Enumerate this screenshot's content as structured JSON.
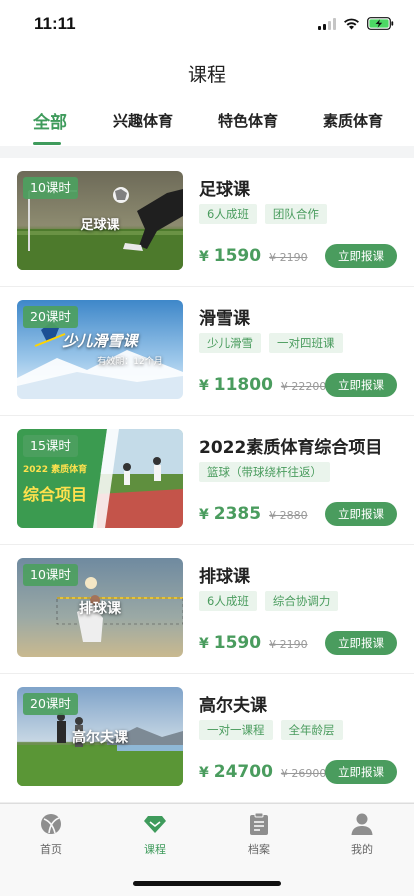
{
  "status_bar": {
    "time": "11:11"
  },
  "header": {
    "title": "课程"
  },
  "tabs": [
    {
      "label": "全部",
      "active": true
    },
    {
      "label": "兴趣体育"
    },
    {
      "label": "特色体育"
    },
    {
      "label": "素质体育"
    }
  ],
  "courses": [
    {
      "lessons": "10课时",
      "image_caption": "足球课",
      "title": "足球课",
      "tags": [
        "6人成班",
        "团队合作"
      ],
      "currency": "¥",
      "price": "1590",
      "original_price": "¥ 2190",
      "button": "立即报课"
    },
    {
      "lessons": "20课时",
      "image_caption": "少儿滑雪课",
      "image_subcaption": "有效期：12个月",
      "title": "滑雪课",
      "tags": [
        "少儿滑雪",
        "一对四班课"
      ],
      "currency": "¥",
      "price": "11800",
      "original_price": "¥ 22200",
      "button": "立即报课"
    },
    {
      "lessons": "15课时",
      "image_caption": "综合项目",
      "image_subcaption": "2022 素质体育",
      "title": "2022素质体育综合项目",
      "tags": [
        "篮球（带球绕杆往返）"
      ],
      "currency": "¥",
      "price": "2385",
      "original_price": "¥ 2880",
      "button": "立即报课"
    },
    {
      "lessons": "10课时",
      "image_caption": "排球课",
      "title": "排球课",
      "tags": [
        "6人成班",
        "综合协调力"
      ],
      "currency": "¥",
      "price": "1590",
      "original_price": "¥ 2190",
      "button": "立即报课"
    },
    {
      "lessons": "20课时",
      "image_caption": "高尔夫课",
      "title": "高尔夫课",
      "tags": [
        "一对一课程",
        "全年龄层"
      ],
      "currency": "¥",
      "price": "24700",
      "original_price": "¥ 26900",
      "button": "立即报课"
    }
  ],
  "bottom_nav": [
    {
      "label": "首页",
      "icon": "ball-icon"
    },
    {
      "label": "课程",
      "icon": "diamond-icon",
      "active": true
    },
    {
      "label": "档案",
      "icon": "clipboard-icon"
    },
    {
      "label": "我的",
      "icon": "person-icon"
    }
  ],
  "colors": {
    "accent": "#4a9c5e",
    "tag_bg": "#eaf4ec"
  }
}
